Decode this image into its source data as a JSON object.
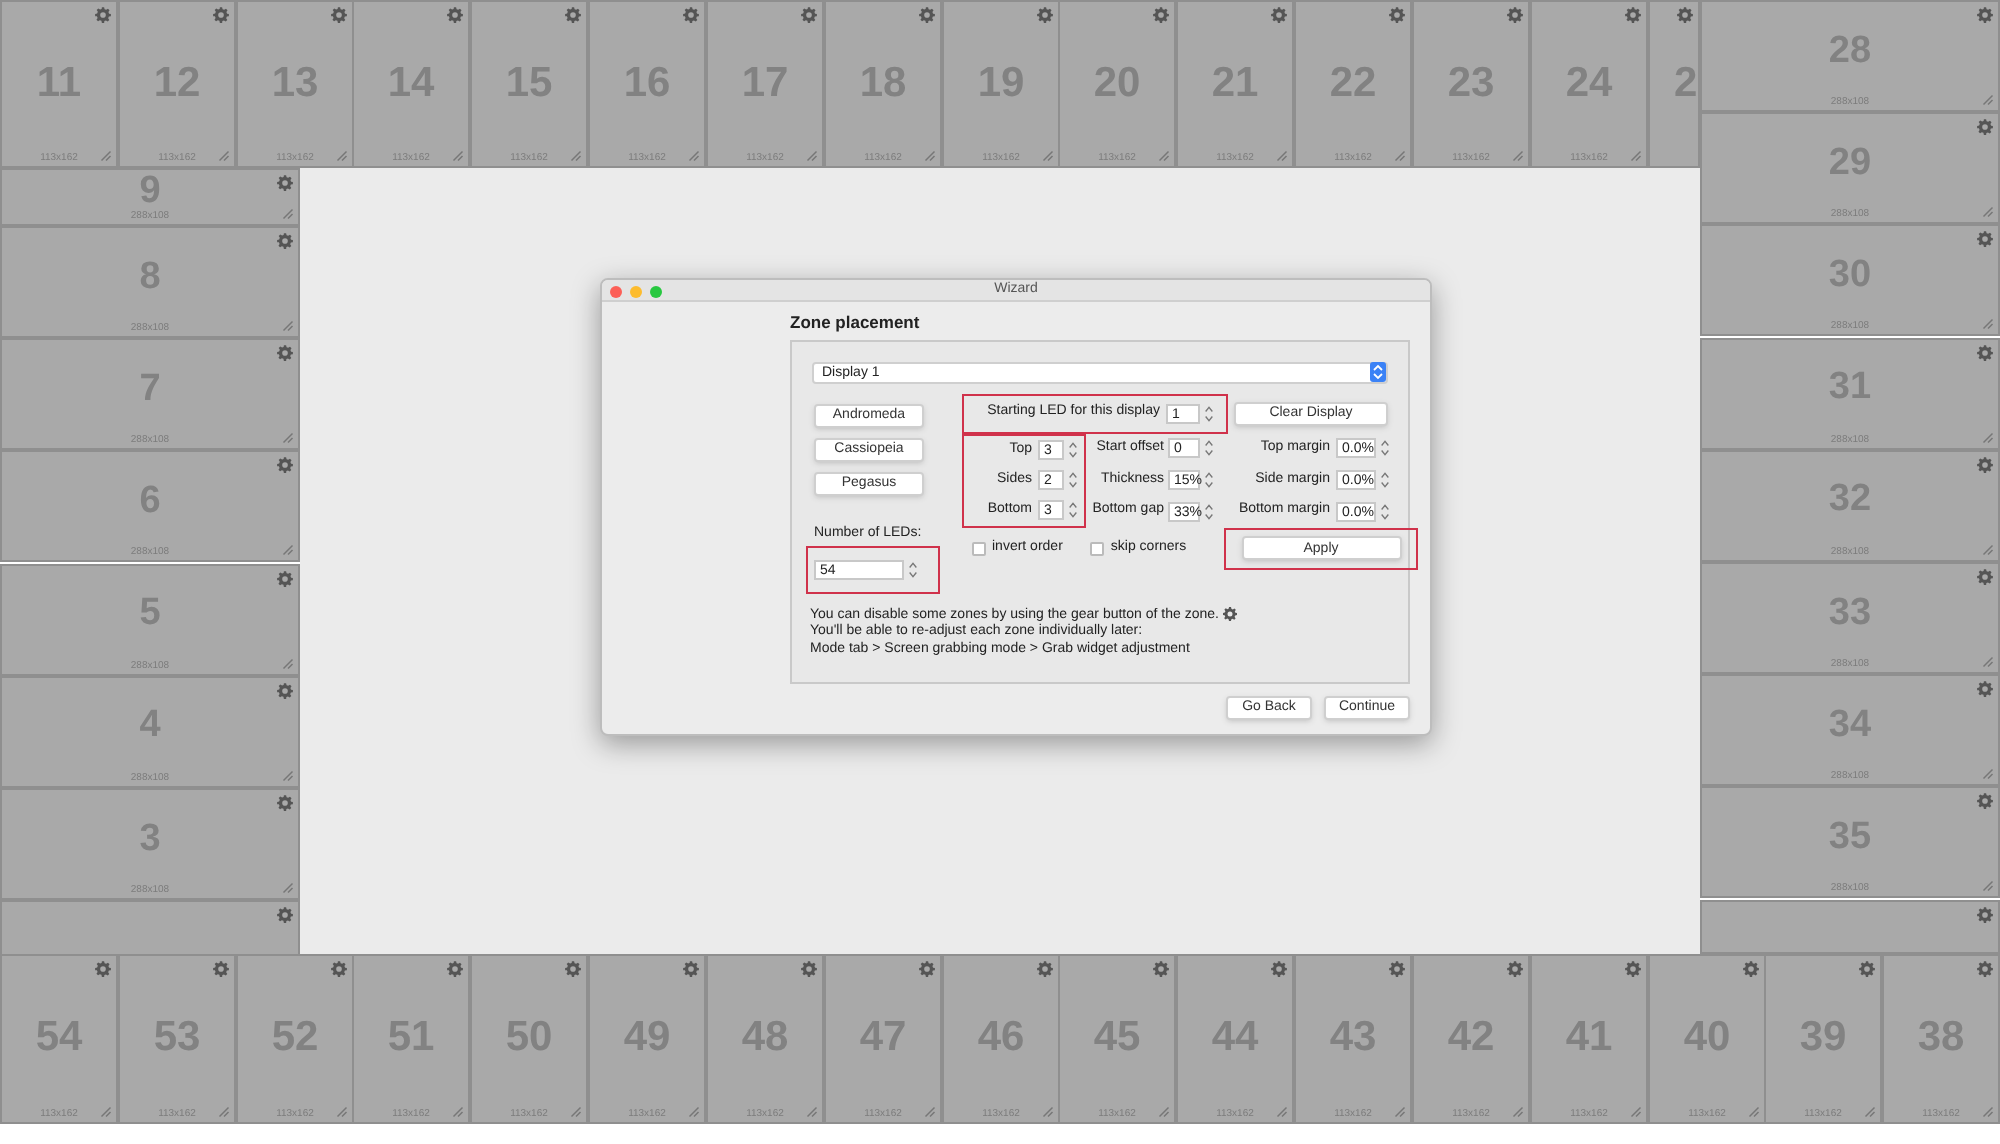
{
  "zones": {
    "top": [
      {
        "number": "11",
        "size": "113x162"
      },
      {
        "number": "12",
        "size": "113x162"
      },
      {
        "number": "13",
        "size": "113x162"
      },
      {
        "number": "14",
        "size": "113x162"
      },
      {
        "number": "15",
        "size": "113x162"
      },
      {
        "number": "16",
        "size": "113x162"
      },
      {
        "number": "17",
        "size": "113x162"
      },
      {
        "number": "18",
        "size": "113x162"
      },
      {
        "number": "19",
        "size": "113x162"
      },
      {
        "number": "20",
        "size": "113x162"
      },
      {
        "number": "21",
        "size": "113x162"
      },
      {
        "number": "22",
        "size": "113x162"
      },
      {
        "number": "23",
        "size": "113x162"
      },
      {
        "number": "24",
        "size": "113x162"
      },
      {
        "number": "2",
        "partial": true
      }
    ],
    "right": [
      {
        "number": "28",
        "size": "288x108"
      },
      {
        "number": "29",
        "size": "288x108"
      },
      {
        "number": "30",
        "size": "288x108"
      },
      {
        "number": "31",
        "size": "288x108"
      },
      {
        "number": "32",
        "size": "288x108"
      },
      {
        "number": "33",
        "size": "288x108"
      },
      {
        "number": "34",
        "size": "288x108"
      },
      {
        "number": "35",
        "size": "288x108"
      },
      {
        "partial": true
      }
    ],
    "left": [
      {
        "number": "9",
        "size": "288x108"
      },
      {
        "number": "8",
        "size": "288x108"
      },
      {
        "number": "7",
        "size": "288x108"
      },
      {
        "number": "6",
        "size": "288x108"
      },
      {
        "number": "5",
        "size": "288x108"
      },
      {
        "number": "4",
        "size": "288x108"
      },
      {
        "number": "3",
        "size": "288x108"
      },
      {
        "partial": true
      }
    ],
    "bottom": [
      {
        "number": "54",
        "size": "113x162"
      },
      {
        "number": "53",
        "size": "113x162"
      },
      {
        "number": "52",
        "size": "113x162"
      },
      {
        "number": "51",
        "size": "113x162"
      },
      {
        "number": "50",
        "size": "113x162"
      },
      {
        "number": "49",
        "size": "113x162"
      },
      {
        "number": "48",
        "size": "113x162"
      },
      {
        "number": "47",
        "size": "113x162"
      },
      {
        "number": "46",
        "size": "113x162"
      },
      {
        "number": "45",
        "size": "113x162"
      },
      {
        "number": "44",
        "size": "113x162"
      },
      {
        "number": "43",
        "size": "113x162"
      },
      {
        "number": "42",
        "size": "113x162"
      },
      {
        "number": "41",
        "size": "113x162"
      },
      {
        "number": "40",
        "size": "113x162"
      },
      {
        "number": "39",
        "size": "113x162"
      },
      {
        "number": "38",
        "size": "113x162"
      }
    ]
  },
  "dialog": {
    "title": "Wizard",
    "heading": "Zone placement",
    "display_select": "Display 1",
    "presets": [
      "Andromeda",
      "Cassiopeia",
      "Pegasus"
    ],
    "led_count": {
      "label": "Number of LEDs:",
      "value": "54",
      "highlighted": true
    },
    "starting_led": {
      "label": "Starting LED for this display",
      "value": "1",
      "highlighted": true
    },
    "clear_button": "Clear Display",
    "counts": {
      "highlighted": true,
      "fields": [
        {
          "label": "Top",
          "value": "3"
        },
        {
          "label": "Sides",
          "value": "2"
        },
        {
          "label": "Bottom",
          "value": "3"
        }
      ]
    },
    "offsets": [
      {
        "label": "Start offset",
        "value": "0"
      },
      {
        "label": "Thickness",
        "value": "15%"
      },
      {
        "label": "Bottom gap",
        "value": "33%"
      }
    ],
    "margins": [
      {
        "label": "Top margin",
        "value": "0.0%"
      },
      {
        "label": "Side margin",
        "value": "0.0%"
      },
      {
        "label": "Bottom margin",
        "value": "0.0%"
      }
    ],
    "checkboxes": [
      {
        "label": "invert order",
        "checked": false
      },
      {
        "label": "skip corners",
        "checked": false
      }
    ],
    "apply": {
      "label": "Apply",
      "highlighted": true
    },
    "notes": [
      "You can disable some zones by using the gear button of the zone.",
      "You'll be able to re-adjust each zone individually later:",
      "Mode tab > Screen grabbing mode > Grab widget adjustment"
    ],
    "buttons": [
      "Go Back",
      "Continue"
    ]
  }
}
